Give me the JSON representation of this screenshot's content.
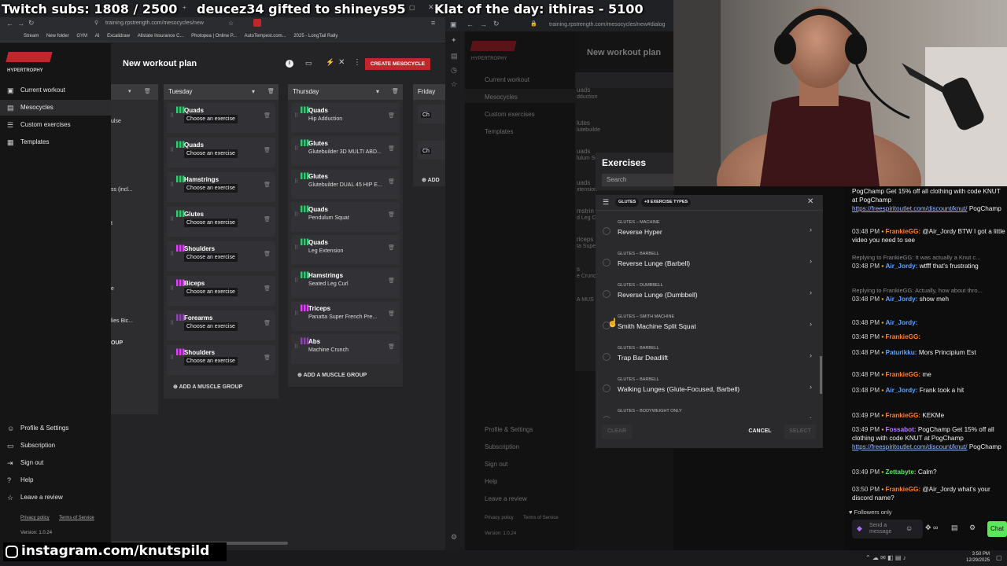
{
  "stream_overlay": {
    "subs": "Twitch subs: 1808 / 2500",
    "gift": "deucez34 gifted to shineys95",
    "klat": "Klat of the day: ithiras - 5100",
    "instagram": "instagram.com/knutspild"
  },
  "left_browser": {
    "url": "training.rpstrength.com/mesocycles/new",
    "bookmarks": [
      "Stream",
      "New folder",
      "GYM",
      "AI",
      "Excalidraw",
      "Allstate Insurance C...",
      "Photopea | Online P...",
      "AutoTempest.com...",
      "2025 - LongTail Rally"
    ],
    "brand": "HYPERTROPHY",
    "nav": [
      "Current workout",
      "Mesocycles",
      "Custom exercises",
      "Templates"
    ],
    "nav_bottom": [
      "Profile & Settings",
      "Subscription",
      "Sign out",
      "Help",
      "Leave a review"
    ],
    "footer_links": [
      "Privacy policy",
      "Terms of Service"
    ],
    "version": "Version: 1.0.24",
    "page_title": "New workout plan",
    "create_button": "CREATE MESOCYCLE",
    "partial_col": [
      "ulse",
      "ss (incl...",
      "t",
      "e",
      "lies Bic...",
      "OUP"
    ],
    "days": [
      {
        "name": "Tuesday",
        "items": [
          {
            "group": "Quads",
            "exercise": "Choose an exercise",
            "empty": true
          },
          {
            "group": "Quads",
            "exercise": "Choose an exercise",
            "empty": true
          },
          {
            "group": "Hamstrings",
            "exercise": "Choose an exercise",
            "empty": true
          },
          {
            "group": "Glutes",
            "exercise": "Choose an exercise",
            "empty": true
          },
          {
            "group": "Shoulders",
            "exercise": "Choose an exercise",
            "empty": true
          },
          {
            "group": "Biceps",
            "exercise": "Choose an exercise",
            "empty": true
          },
          {
            "group": "Forearms",
            "exercise": "Choose an exercise",
            "empty": true
          },
          {
            "group": "Shoulders",
            "exercise": "Choose an exercise",
            "empty": true
          }
        ],
        "add": "ADD A MUSCLE GROUP"
      },
      {
        "name": "Thursday",
        "items": [
          {
            "group": "Quads",
            "exercise": "Hip Adduction",
            "empty": false
          },
          {
            "group": "Glutes",
            "exercise": "Glutebuilder 3D MULTI ABD...",
            "empty": false
          },
          {
            "group": "Glutes",
            "exercise": "Glutebuilder DUAL 45 HIP E...",
            "empty": false
          },
          {
            "group": "Quads",
            "exercise": "Pendulum Squat",
            "empty": false
          },
          {
            "group": "Quads",
            "exercise": "Leg Extension",
            "empty": false
          },
          {
            "group": "Hamstrings",
            "exercise": "Seated Leg Curl",
            "empty": false
          },
          {
            "group": "Triceps",
            "exercise": "Panatta Super French Pre...",
            "empty": false
          },
          {
            "group": "Abs",
            "exercise": "Machine Crunch",
            "empty": false
          }
        ],
        "add": "ADD A MUSCLE GROUP"
      }
    ],
    "friday": {
      "name": "Friday",
      "partial": [
        "Ch",
        "Ch"
      ],
      "add": "ADD"
    }
  },
  "right_browser": {
    "url": "training.rpstrength.com/mesocycles/new#dialog",
    "page_title": "New workout plan",
    "bg_partial": [
      "uads",
      "dduction",
      "lutes",
      "lutebuilde",
      "uads",
      "lulum Sq",
      "uads",
      "xtension",
      "mstrin",
      "d Leg C",
      "riceps",
      "ta Supe",
      "s",
      "e Crunch",
      "A MUS"
    ],
    "modal": {
      "title": "Exercises",
      "search_placeholder": "Search",
      "filter_chip": "GLUTES",
      "types_chip": "+9 EXERCISE TYPES",
      "exercises": [
        {
          "category": "GLUTES – MACHINE",
          "name": "Reverse Hyper"
        },
        {
          "category": "GLUTES – BARBELL",
          "name": "Reverse Lunge (Barbell)"
        },
        {
          "category": "GLUTES – DUMBBELL",
          "name": "Reverse Lunge (Dumbbell)"
        },
        {
          "category": "GLUTES – SMITH MACHINE",
          "name": "Smith Machine Split Squat"
        },
        {
          "category": "GLUTES – BARBELL",
          "name": "Trap Bar Deadlift"
        },
        {
          "category": "GLUTES – BARBELL",
          "name": "Walking Lunges (Glute-Focused, Barbell)"
        },
        {
          "category": "GLUTES – BODYWEIGHT ONLY",
          "name": ""
        }
      ],
      "clear": "CLEAR",
      "cancel": "CANCEL",
      "select": "SELECT"
    }
  },
  "chat": {
    "messages": [
      {
        "ts": "",
        "user": "",
        "text": "PogChamp Get 15% off all clothing with code KNUT at PogChamp ",
        "link": "https://freespiritoutlet.com/discount/knut/",
        "after": " PogChamp"
      },
      {
        "ts": "03:48 PM",
        "user": "FrankieGG:",
        "text": " @Air_Jordy BTW I got a little video you need to see"
      },
      {
        "reply": "Replying to FrankieGG: It was actually a Knut c..."
      },
      {
        "ts": "03:48 PM",
        "user": "Air_Jordy:",
        "text": " wtfff that's frustrating"
      },
      {
        "reply": "Replying to FrankieGG: Actually, how about thro..."
      },
      {
        "ts": "03:48 PM",
        "user": "Air_Jordy:",
        "text": " show meh"
      },
      {
        "ts": "03:48 PM",
        "user": "Air_Jordy:",
        "text": ""
      },
      {
        "ts": "03:48 PM",
        "user": "FrankieGG:",
        "text": ""
      },
      {
        "ts": "03:48 PM",
        "user": "Paturikku:",
        "text": " Mors Principium Est"
      },
      {
        "ts": "03:48 PM",
        "user": "FrankieGG:",
        "text": " me"
      },
      {
        "ts": "03:48 PM",
        "user": "Air_Jordy:",
        "text": " Frank took a hit"
      },
      {
        "ts": "03:49 PM",
        "user": "FrankieGG:",
        "text": " KEKMe"
      },
      {
        "ts": "03:49 PM",
        "user": "Fossabot:",
        "text": " PogChamp Get 15% off all clothing with code KNUT at PogChamp ",
        "link": "https://freespiritoutlet.com/discount/knut/",
        "after": " PogChamp"
      },
      {
        "ts": "03:49 PM",
        "user": "Zettabyte:",
        "text": " Calm?"
      },
      {
        "ts": "03:50 PM",
        "user": "FrankieGG:",
        "text": " @Air_Jordy what's your discord name?"
      }
    ],
    "followers_only": "Followers only",
    "send_placeholder": "Send a message",
    "chat_button": "Chat"
  },
  "taskbar": {
    "time": "3:50 PM",
    "date": "12/29/2025"
  },
  "colors": {
    "accent_red": "#c0272d",
    "quads": "#2ecc71",
    "glutes": "#2ecc71",
    "hamstrings": "#2ecc71",
    "shoulders": "#e040fb",
    "biceps": "#e040fb",
    "forearms": "#8e44ad",
    "triceps": "#e040fb",
    "abs": "#8e44ad"
  }
}
